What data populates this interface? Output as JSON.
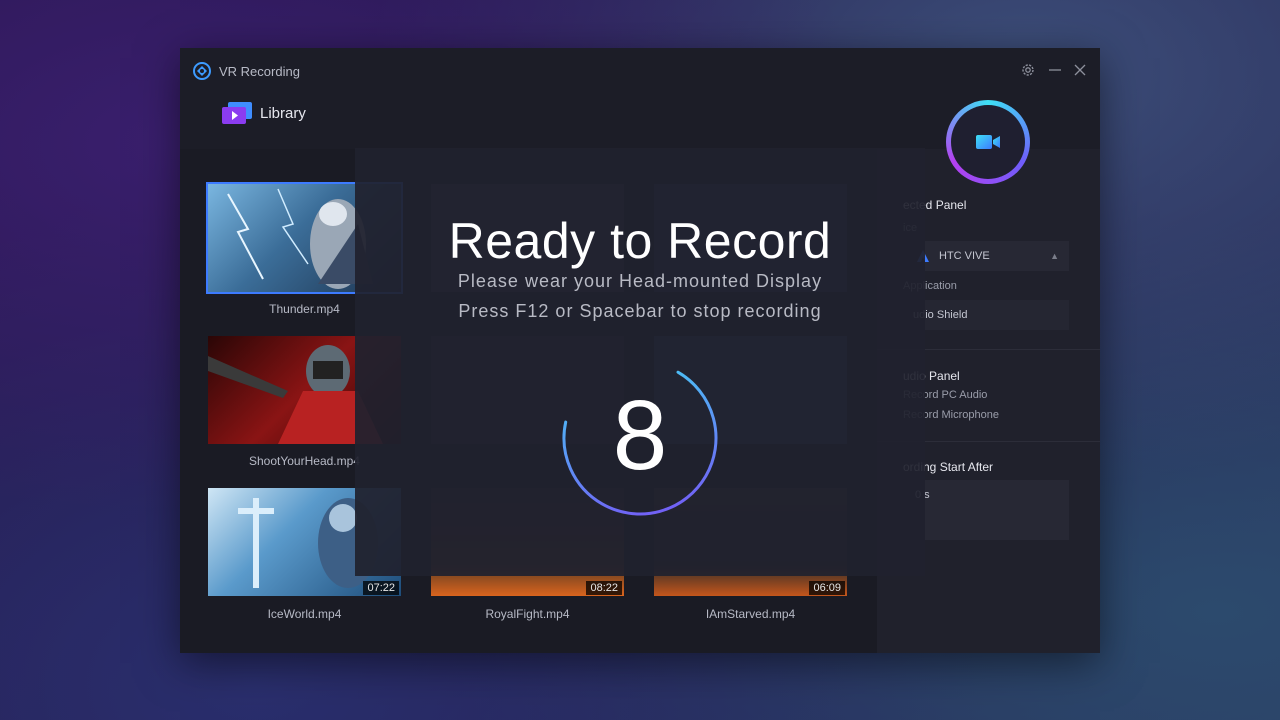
{
  "window": {
    "title": "VR Recording",
    "settings_icon": "gear-icon",
    "minimize_icon": "minimize-icon",
    "close_icon": "close-icon"
  },
  "library": {
    "label": "Library"
  },
  "videos": [
    {
      "name": "Thunder.mp4",
      "duration": ""
    },
    {
      "name": "",
      "duration": ""
    },
    {
      "name": "",
      "duration": ""
    },
    {
      "name": "ShootYourHead.mp4",
      "duration": ""
    },
    {
      "name": "",
      "duration": ""
    },
    {
      "name": "",
      "duration": ""
    },
    {
      "name": "IceWorld.mp4",
      "duration": "07:22"
    },
    {
      "name": "RoyalFight.mp4",
      "duration": "08:22"
    },
    {
      "name": "IAmStarved.mp4",
      "duration": "06:09"
    }
  ],
  "side_panel": {
    "connected_panel_title": "ected Panel",
    "device_label": "ice",
    "device_value": "HTC VIVE",
    "application_label": "Application",
    "application_value": "udio Shield",
    "audio_panel_title": "udio Panel",
    "record_pc_audio": "Record PC Audio",
    "record_microphone": "Record Microphone",
    "recording_start_title": "ording Start After",
    "recording_start_value": "0 s"
  },
  "overlay": {
    "title": "Ready to Record",
    "line1": "Please wear your Head-mounted Display",
    "line2": "Press F12 or Spacebar to stop recording",
    "countdown": "8",
    "countdown_progress": 0.7
  },
  "colors": {
    "accent_blue": "#3d7bff",
    "ring_cyan": "#3ee0f5",
    "ring_purple": "#6f5dfa"
  }
}
